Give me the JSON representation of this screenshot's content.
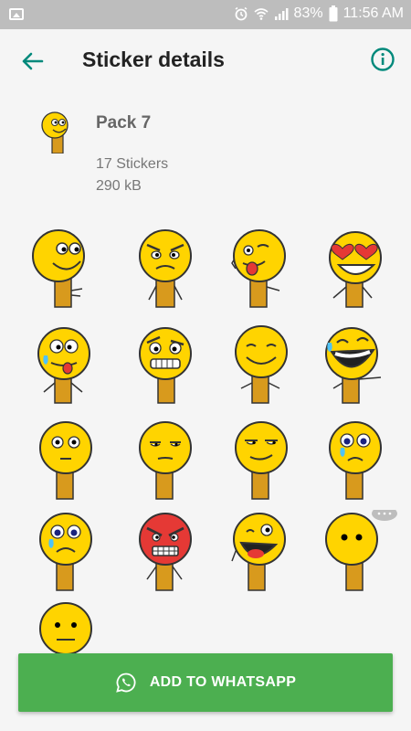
{
  "status_bar": {
    "battery": "83%",
    "time": "11:56 AM"
  },
  "app_bar": {
    "title": "Sticker details"
  },
  "pack": {
    "name": "Pack 7",
    "count": "17 Stickers",
    "size": "290 kB"
  },
  "stickers": [
    "smiling",
    "angry-frown",
    "tongue-wink",
    "heart-eyes",
    "silly-tongue-crying",
    "grimace",
    "content-smile",
    "laughing-tears",
    "wide-eyed",
    "unamused",
    "sly-smirk",
    "crying-tear",
    "sad-tear",
    "angry-red",
    "winking-laugh",
    "speechless-dots",
    "neutral"
  ],
  "action": {
    "add_label": "ADD TO WHATSAPP"
  },
  "colors": {
    "accent": "#00897b",
    "button": "#4caf50",
    "sticker_yellow": "#ffd400",
    "neck_orange": "#d89a1d"
  }
}
